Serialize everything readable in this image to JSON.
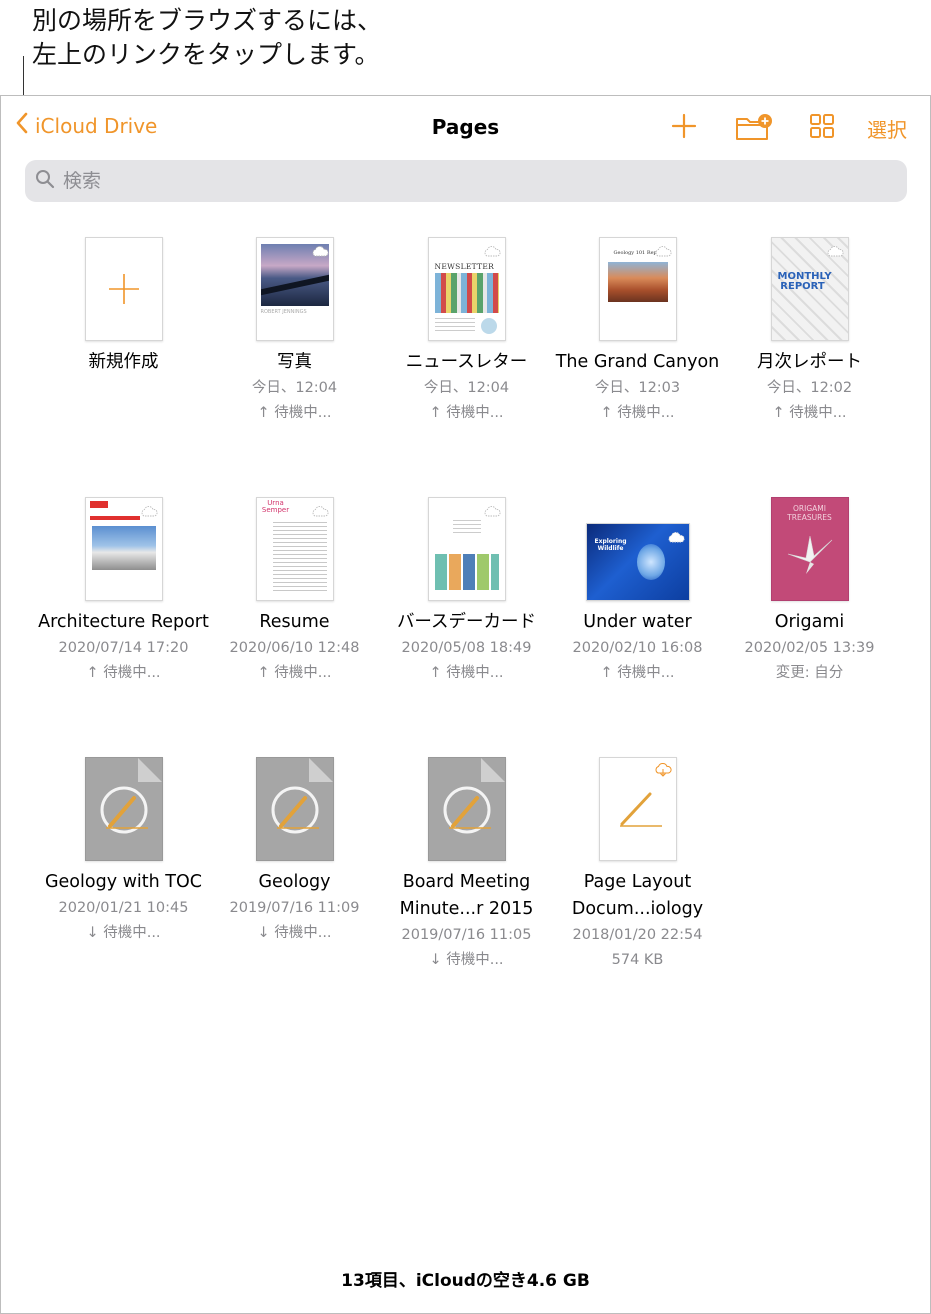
{
  "callout": {
    "line1": "別の場所をブラウズするには、",
    "line2": "左上のリンクをタップします。"
  },
  "nav": {
    "back_label": "iCloud Drive",
    "title": "Pages",
    "select_label": "選択"
  },
  "search": {
    "placeholder": "検索"
  },
  "colors": {
    "accent": "#f0952a",
    "meta": "#8a8a8e",
    "search_bg": "#e4e4e7"
  },
  "items": [
    {
      "name": "新規作成",
      "meta1": "",
      "meta2": "",
      "meta3": ""
    },
    {
      "name": "写真",
      "meta1": "今日、12:04",
      "meta2": "↑ 待機中...",
      "meta3": ""
    },
    {
      "name": "ニュースレター",
      "meta1": "今日、12:04",
      "meta2": "↑ 待機中...",
      "meta3": ""
    },
    {
      "name": "The Grand Canyon",
      "meta1": "今日、12:03",
      "meta2": "↑ 待機中...",
      "meta3": ""
    },
    {
      "name": "月次レポート",
      "meta1": "今日、12:02",
      "meta2": "↑ 待機中...",
      "meta3": ""
    },
    {
      "name": "Architecture Report",
      "meta1": "2020/07/14 17:20",
      "meta2": "↑ 待機中...",
      "meta3": ""
    },
    {
      "name": "Resume",
      "meta1": "2020/06/10 12:48",
      "meta2": "↑ 待機中...",
      "meta3": ""
    },
    {
      "name": "バースデーカード",
      "meta1": "2020/05/08 18:49",
      "meta2": "↑ 待機中...",
      "meta3": ""
    },
    {
      "name": "Under water",
      "meta1": "2020/02/10 16:08",
      "meta2": "↑ 待機中...",
      "meta3": ""
    },
    {
      "name": "Origami",
      "meta1": "2020/02/05 13:39",
      "meta2": "変更: 自分",
      "meta3": ""
    },
    {
      "name": "Geology with TOC",
      "meta1": "2020/01/21 10:45",
      "meta2": "↓ 待機中...",
      "meta3": ""
    },
    {
      "name": "Geology",
      "meta1": "2019/07/16 11:09",
      "meta2": "↓ 待機中...",
      "meta3": ""
    },
    {
      "name": "Board Meeting Minute...r 2015",
      "meta1": "2019/07/16 11:05",
      "meta2": "↓ 待機中...",
      "meta3": ""
    },
    {
      "name": "Page Layout Docum...iology",
      "meta1": "2018/01/20 22:54",
      "meta2": "574 KB",
      "meta3": ""
    }
  ],
  "thumb_text": {
    "photo_caption": "ROBERT JENNINGS",
    "newsletter": "NEWSLETTER",
    "canyon_title": "Geology 101 Report",
    "monthly": "MONTHLY REPORT",
    "resume_name": "Urna Semper",
    "underwater": "Exploring Wildlife",
    "origami": "ORIGAMI TREASURES"
  },
  "footer": {
    "status": "13項目、iCloudの空き4.6 GB"
  }
}
